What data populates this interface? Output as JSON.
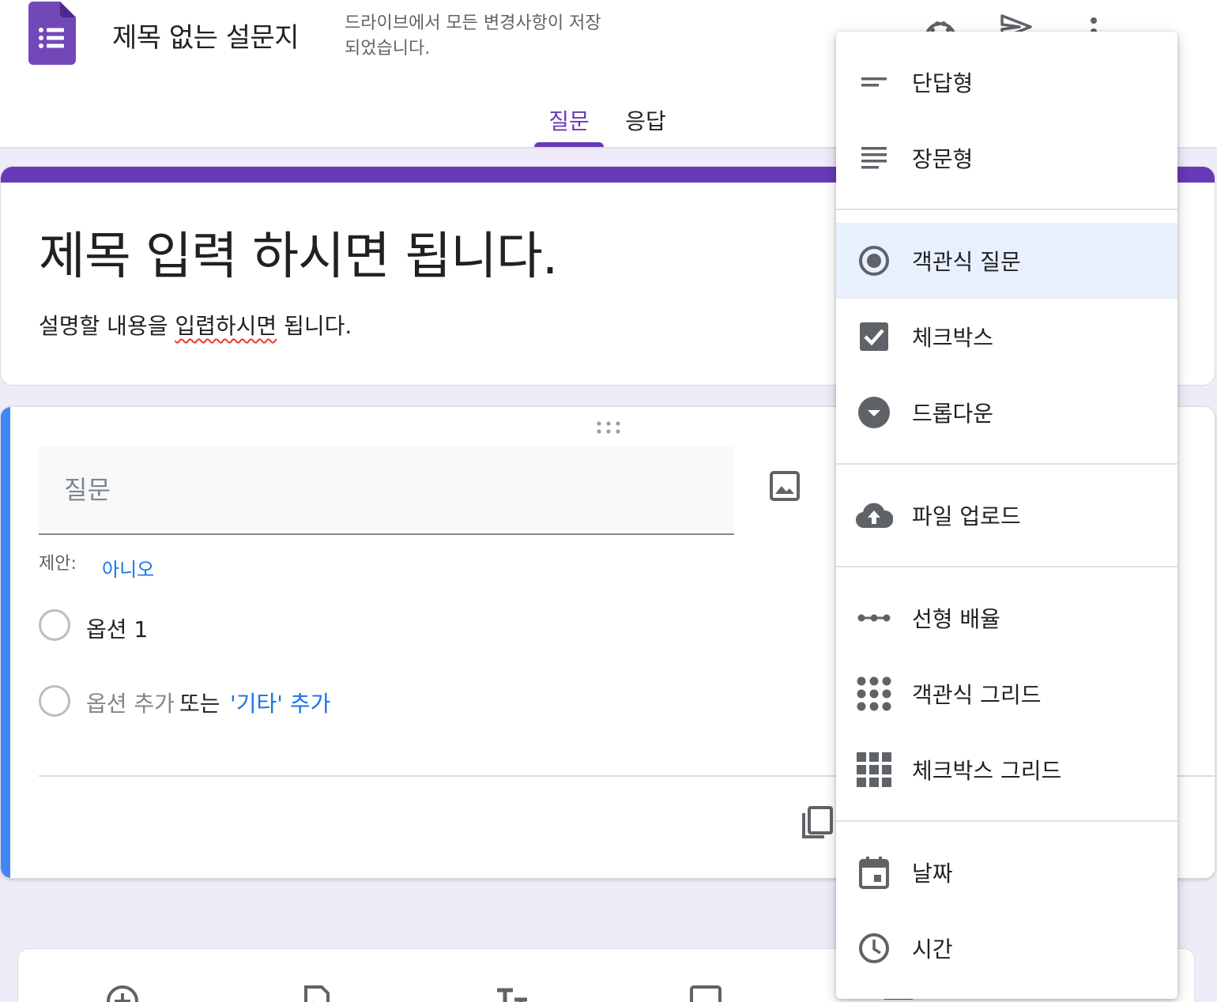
{
  "header": {
    "doc_title": "제목 없는 설문지",
    "save_status": "드라이브에서 모든 변경사항이 저장되었습니다.",
    "icons": [
      "palette-icon",
      "send-icon",
      "more-vert-icon"
    ]
  },
  "tabs": {
    "questions": "질문",
    "responses": "응답",
    "active": "questions"
  },
  "form": {
    "title": "제목 입력 하시면 됩니다.",
    "description_before": "설명할 내용을 ",
    "description_misspelled": "입렵하시면",
    "description_after": " 됩니다."
  },
  "question": {
    "placeholder": "질문",
    "suggestion_label": "제안:",
    "suggestion_value": "아니오",
    "option1": "옵션 1",
    "add_option": "옵션 추가",
    "or_text": "또는",
    "add_other": "'기타' 추가"
  },
  "type_menu": {
    "items": [
      {
        "label": "단답형",
        "icon": "short-answer-icon"
      },
      {
        "label": "장문형",
        "icon": "paragraph-icon"
      },
      {
        "label": "객관식 질문",
        "icon": "radio-button-icon",
        "selected": true
      },
      {
        "label": "체크박스",
        "icon": "checkbox-icon"
      },
      {
        "label": "드롭다운",
        "icon": "dropdown-icon"
      },
      {
        "label": "파일 업로드",
        "icon": "cloud-upload-icon"
      },
      {
        "label": "선형 배율",
        "icon": "linear-scale-icon"
      },
      {
        "label": "객관식 그리드",
        "icon": "dot-grid-icon"
      },
      {
        "label": "체크박스 그리드",
        "icon": "square-grid-icon"
      },
      {
        "label": "날짜",
        "icon": "calendar-icon"
      },
      {
        "label": "시간",
        "icon": "clock-icon"
      }
    ]
  },
  "colors": {
    "brand_purple": "#673ab7",
    "accent_blue": "#4285f4",
    "link_blue": "#1a73e8",
    "page_bg": "#f0ebf8",
    "selected_bg": "#e8f0fe"
  }
}
